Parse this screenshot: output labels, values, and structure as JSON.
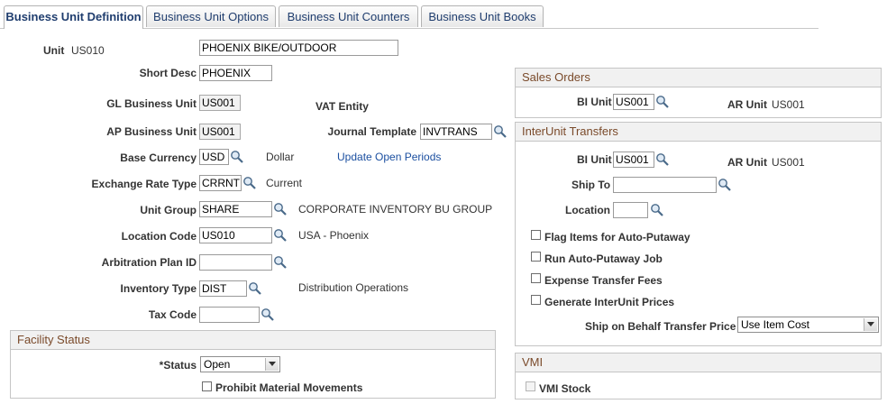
{
  "tabs": [
    {
      "label": "Business Unit Definition",
      "active": true
    },
    {
      "label": "Business Unit Options",
      "active": false
    },
    {
      "label": "Business Unit Counters",
      "active": false
    },
    {
      "label": "Business Unit Books",
      "active": false
    }
  ],
  "form": {
    "unit_label": "Unit",
    "unit_value": "US010",
    "unit_descr": "PHOENIX BIKE/OUTDOOR",
    "short_desc_label": "Short Desc",
    "short_desc_value": "PHOENIX",
    "gl_bu_label": "GL Business Unit",
    "gl_bu_value": "US001",
    "vat_entity_label": "VAT Entity",
    "ap_bu_label": "AP Business Unit",
    "ap_bu_value": "US001",
    "journal_template_label": "Journal Template",
    "journal_template_value": "INVTRANS",
    "base_currency_label": "Base Currency",
    "base_currency_value": "USD",
    "base_currency_descr": "Dollar",
    "update_open_periods_link": "Update Open Periods",
    "exchange_rate_type_label": "Exchange Rate Type",
    "exchange_rate_type_value": "CRRNT",
    "exchange_rate_type_descr": "Current",
    "unit_group_label": "Unit Group",
    "unit_group_value": "SHARE",
    "unit_group_descr": "CORPORATE INVENTORY BU GROUP",
    "location_code_label": "Location Code",
    "location_code_value": "US010",
    "location_code_descr": "USA - Phoenix",
    "arbitration_plan_label": "Arbitration Plan ID",
    "arbitration_plan_value": "",
    "inventory_type_label": "Inventory Type",
    "inventory_type_value": "DIST",
    "inventory_type_descr": "Distribution Operations",
    "tax_code_label": "Tax Code",
    "tax_code_value": ""
  },
  "facility_status": {
    "title": "Facility Status",
    "status_label": "*Status",
    "status_value": "Open",
    "prohibit_label": "Prohibit Material Movements",
    "prohibit_checked": false
  },
  "sales_orders": {
    "title": "Sales Orders",
    "bi_unit_label": "BI Unit",
    "bi_unit_value": "US001",
    "ar_unit_label": "AR Unit",
    "ar_unit_value": "US001"
  },
  "interunit": {
    "title": "InterUnit Transfers",
    "bi_unit_label": "BI Unit",
    "bi_unit_value": "US001",
    "ar_unit_label": "AR Unit",
    "ar_unit_value": "US001",
    "ship_to_label": "Ship To",
    "ship_to_value": "",
    "location_label": "Location",
    "location_value": "",
    "checkboxes": [
      {
        "label": "Flag Items for Auto-Putaway",
        "checked": false
      },
      {
        "label": "Run Auto-Putaway Job",
        "checked": false
      },
      {
        "label": "Expense Transfer Fees",
        "checked": false
      },
      {
        "label": "Generate InterUnit Prices",
        "checked": false
      }
    ],
    "ship_behalf_label": "Ship on Behalf Transfer Price",
    "ship_behalf_value": "Use Item Cost"
  },
  "vmi": {
    "title": "VMI",
    "vmi_stock_label": "VMI Stock",
    "vmi_stock_checked": false
  },
  "colors": {
    "group_header_text": "#7a4a2a",
    "link": "#1b4fa0",
    "tab_text": "#1f3d6e"
  }
}
